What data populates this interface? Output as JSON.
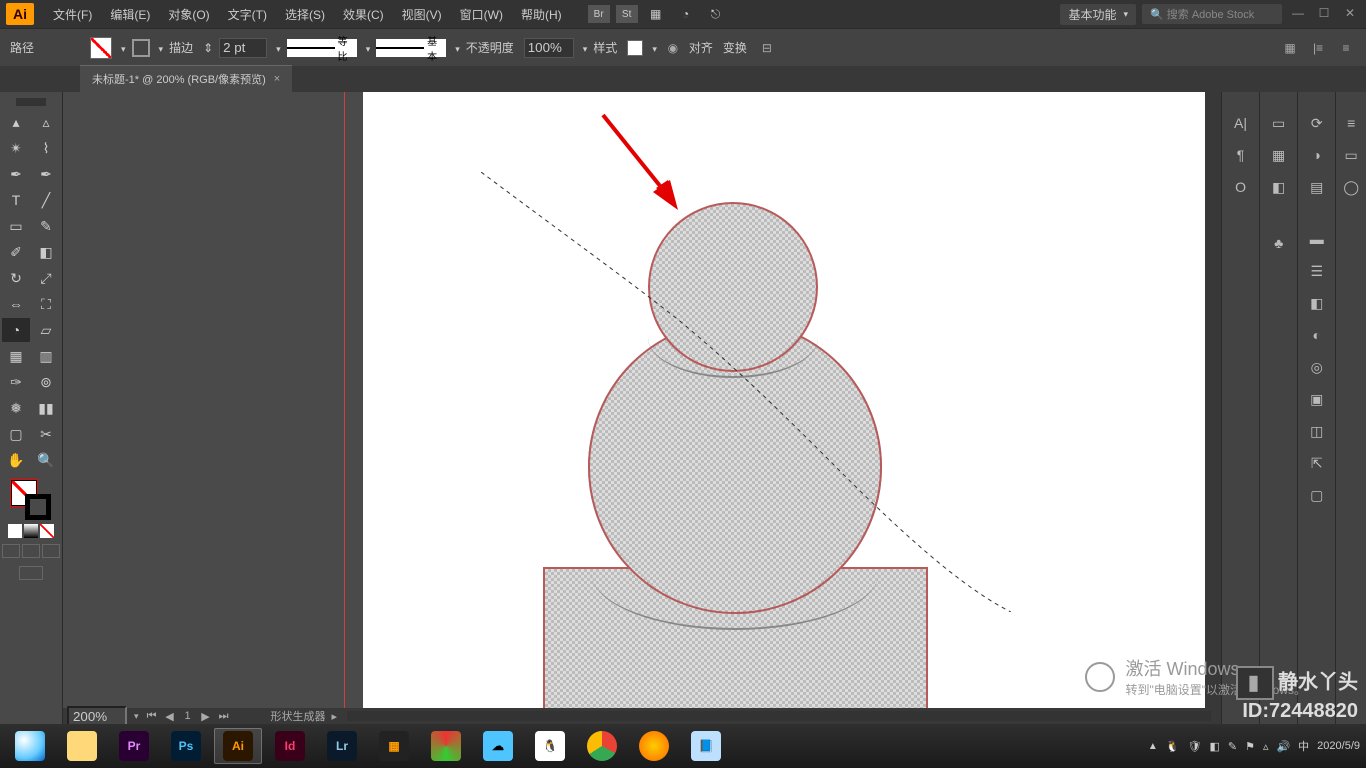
{
  "menubar": {
    "logo": "Ai",
    "items": [
      "文件(F)",
      "编辑(E)",
      "对象(O)",
      "文字(T)",
      "选择(S)",
      "效果(C)",
      "视图(V)",
      "窗口(W)",
      "帮助(H)"
    ],
    "bridge": "Br",
    "stock": "St",
    "workspace_label": "基本功能",
    "search_placeholder": "搜索 Adobe Stock"
  },
  "controlbar": {
    "selection_label": "路径",
    "stroke_label": "描边",
    "stroke_value": "2 pt",
    "profile_label": "等比",
    "brush_label": "基本",
    "opacity_label": "不透明度",
    "opacity_value": "100%",
    "style_label": "样式",
    "align_label": "对齐",
    "transform_label": "变换"
  },
  "doctab": {
    "title": "未标题-1* @ 200% (RGB/像素预览)"
  },
  "status": {
    "zoom": "200%",
    "page": "1",
    "tool": "形状生成器"
  },
  "watermark": {
    "title": "激活 Windows",
    "subtitle": "转到\"电脑设置\"以激活 Windows。"
  },
  "authormark": {
    "line1": "静水丫头",
    "line2": "ID:72448820"
  },
  "taskbar": {
    "datetime": "2020/5/9"
  }
}
